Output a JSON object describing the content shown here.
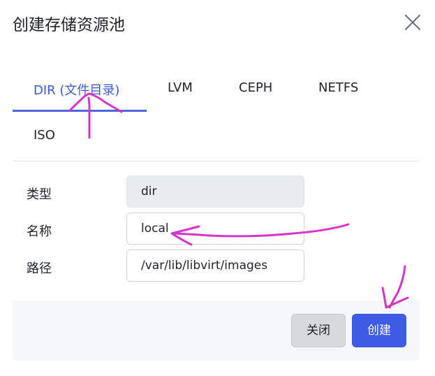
{
  "dialog": {
    "title": "创建存储资源池",
    "close_icon": "close-icon"
  },
  "tabs": [
    {
      "label": "DIR (文件目录)",
      "active": true
    },
    {
      "label": "LVM",
      "active": false
    },
    {
      "label": "CEPH",
      "active": false
    },
    {
      "label": "NETFS",
      "active": false
    },
    {
      "label": "ISO",
      "active": false
    }
  ],
  "form": {
    "type": {
      "label": "类型",
      "value": "dir",
      "readonly": true
    },
    "name": {
      "label": "名称",
      "value": "local"
    },
    "path": {
      "label": "路径",
      "value": "/var/lib/libvirt/images"
    }
  },
  "footer": {
    "close_label": "关闭",
    "create_label": "创建"
  },
  "colors": {
    "accent": "#3c5bd6",
    "primary_button": "#3f5be5",
    "annotation": "#d633c9"
  },
  "annotations": {
    "icons": [
      "arrow-up-annotation",
      "arrow-left-annotation",
      "arrow-down-annotation"
    ]
  }
}
